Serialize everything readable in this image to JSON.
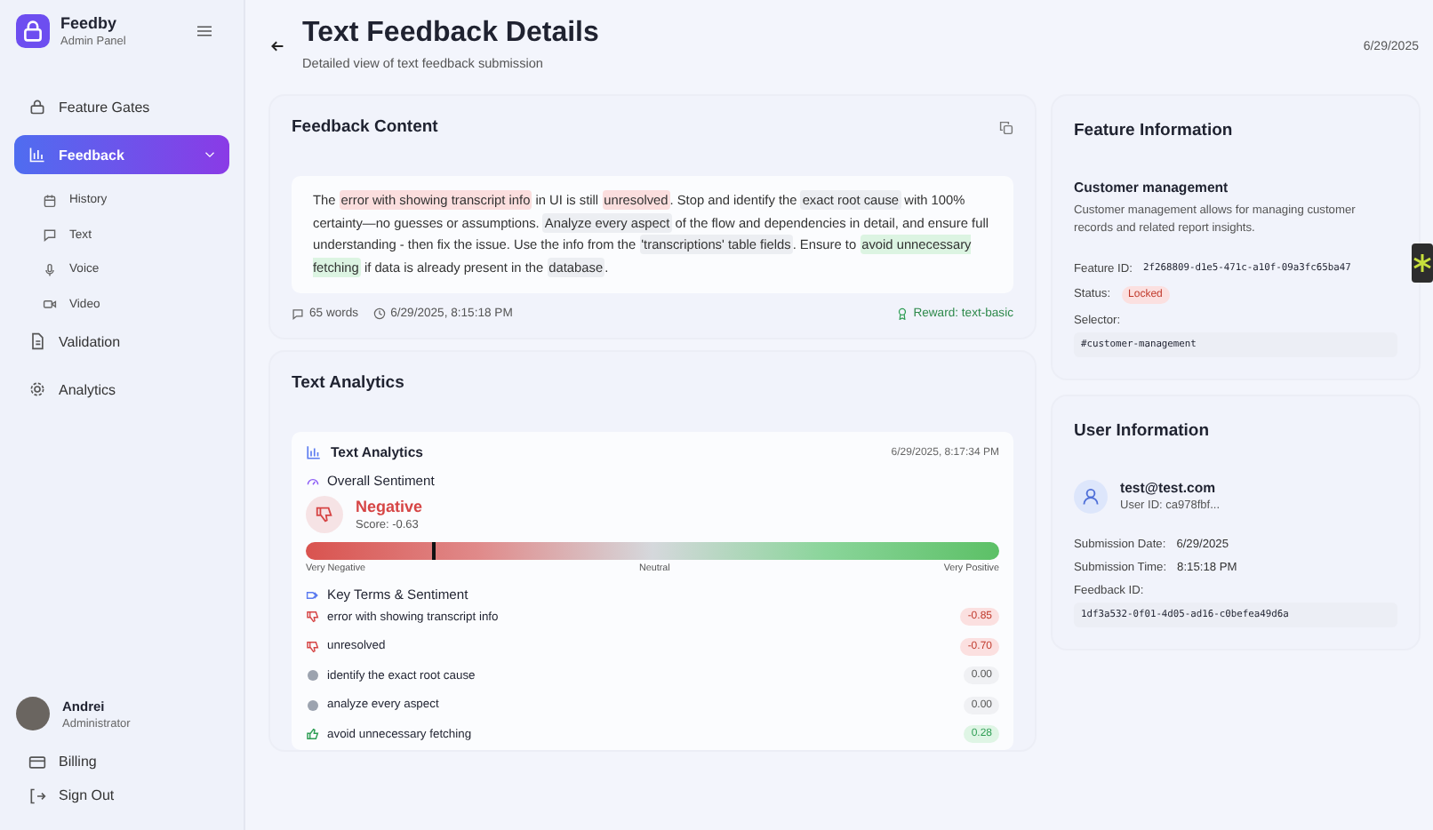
{
  "sidebar": {
    "brand": "Feedby",
    "subtitle": "Admin Panel",
    "items": [
      {
        "label": "Feature Gates",
        "kind": "lock",
        "selected": false
      },
      {
        "label": "Feedback",
        "kind": "chart",
        "selected": true,
        "expanded": true,
        "children": [
          {
            "label": "History",
            "kind": "calendar"
          },
          {
            "label": "Text",
            "kind": "message"
          },
          {
            "label": "Voice",
            "kind": "mic"
          },
          {
            "label": "Video",
            "kind": "video"
          }
        ]
      },
      {
        "label": "Validation",
        "kind": "file",
        "selected": false
      },
      {
        "label": "Analytics",
        "kind": "gear",
        "selected": false
      }
    ],
    "user": {
      "name": "Andrei",
      "role": "Administrator"
    },
    "footer": [
      {
        "label": "Billing",
        "kind": "card"
      },
      {
        "label": "Sign Out",
        "kind": "signout"
      }
    ]
  },
  "header": {
    "title": "Text Feedback Details",
    "subtitle": "Detailed view of text feedback submission",
    "date": "6/29/2025"
  },
  "feedback": {
    "title": "Feedback Content",
    "segments": [
      {
        "text": "The ",
        "kind": "plain"
      },
      {
        "text": "error with showing transcript info",
        "kind": "negative"
      },
      {
        "text": " in UI is still ",
        "kind": "plain"
      },
      {
        "text": "unresolved",
        "kind": "negative"
      },
      {
        "text": ". Stop and identify the ",
        "kind": "plain"
      },
      {
        "text": "exact root cause",
        "kind": "neutral"
      },
      {
        "text": " with 100% certainty—no guesses or assumptions. ",
        "kind": "plain"
      },
      {
        "text": "Analyze every aspect",
        "kind": "neutral"
      },
      {
        "text": " of the flow and dependencies in detail, and ensure full understanding - then fix the issue. Use the info from the ",
        "kind": "plain"
      },
      {
        "text": "'transcriptions' table fields",
        "kind": "neutral"
      },
      {
        "text": ". Ensure to ",
        "kind": "plain"
      },
      {
        "text": "avoid unnecessary fetching",
        "kind": "positive"
      },
      {
        "text": " if data is already present in the ",
        "kind": "plain"
      },
      {
        "text": "database",
        "kind": "neutral"
      },
      {
        "text": ".",
        "kind": "plain"
      }
    ],
    "words": "65 words",
    "timestamp": "6/29/2025, 8:15:18 PM",
    "reward": "Reward: text-basic"
  },
  "analytics": {
    "title": "Text Analytics",
    "panel_title": "Text Analytics",
    "panel_time": "6/29/2025, 8:17:34 PM",
    "sentiment_heading": "Overall Sentiment",
    "sentiment": {
      "kind": "negative",
      "label": "Negative"
    },
    "score": "Score: -0.63",
    "level": 0.185,
    "scale": [
      "Very Negative",
      "Neutral",
      "Very Positive"
    ],
    "terms_heading": "Key Terms & Sentiment",
    "terms": [
      {
        "kind": "negative",
        "term": "error with showing transcript info",
        "value": "-0.85"
      },
      {
        "kind": "negative",
        "term": "unresolved",
        "value": "-0.70"
      },
      {
        "kind": "neutral",
        "term": "identify the exact root cause",
        "value": "0.00"
      },
      {
        "kind": "neutral",
        "term": "analyze every aspect",
        "value": "0.00"
      },
      {
        "kind": "positive",
        "term": "avoid unnecessary fetching",
        "value": "0.28"
      }
    ]
  },
  "feature": {
    "title": "Feature Information",
    "name": "Customer management",
    "description": "Customer management allows for managing customer records and related report insights.",
    "id_label": "Feature ID:",
    "id": "2f268809-d1e5-471c-a10f-09a3fc65ba47",
    "status_label": "Status:",
    "status": {
      "kind": "locked",
      "label": "Locked"
    },
    "selector_label": "Selector:",
    "selector": "#customer-management"
  },
  "user_info": {
    "title": "User Information",
    "email": "test@test.com",
    "user_id": "User ID: ca978fbf...",
    "date_label": "Submission Date:",
    "date": "6/29/2025",
    "time_label": "Submission Time:",
    "time": "8:15:18 PM",
    "feedback_id_label": "Feedback ID:",
    "feedback_id": "1df3a532-0f01-4d05-ad16-c0befea49d6a"
  }
}
